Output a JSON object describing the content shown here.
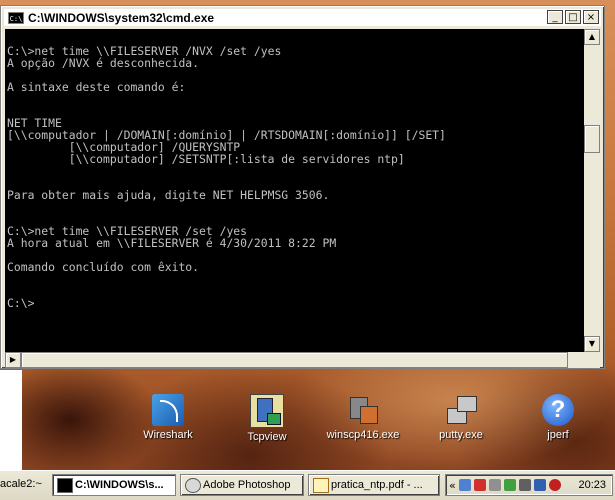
{
  "window": {
    "title": "C:\\WINDOWS\\system32\\cmd.exe",
    "icon_label": "C:\\",
    "buttons": {
      "minimize": "_",
      "maximize": "□",
      "close": "×"
    }
  },
  "console": {
    "lines": [
      "",
      "C:\\>net time \\\\FILESERVER /NVX /set /yes",
      "A opção /NVX é desconhecida.",
      "",
      "A sintaxe deste comando é:",
      "",
      "",
      "NET TIME",
      "[\\\\computador | /DOMAIN[:domínio] | /RTSDOMAIN[:domínio]] [/SET]",
      "         [\\\\computador] /QUERYSNTP",
      "         [\\\\computador] /SETSNTP[:lista de servidores ntp]",
      "",
      "",
      "Para obter mais ajuda, digite NET HELPMSG 3506.",
      "",
      "",
      "C:\\>net time \\\\FILESERVER /set /yes",
      "A hora atual em \\\\FILESERVER é 4/30/2011 8:22 PM",
      "",
      "Comando concluído com êxito.",
      "",
      "",
      "C:\\>"
    ]
  },
  "desktop": {
    "icons": [
      {
        "label": "Wireshark",
        "icon": "wireshark-icon"
      },
      {
        "label": "Tcpview",
        "icon": "tcpview-icon"
      },
      {
        "label": "winscp416.exe",
        "icon": "winscp-icon"
      },
      {
        "label": "putty.exe",
        "icon": "putty-icon"
      },
      {
        "label": "jperf",
        "icon": "jperf-icon",
        "glyph": "?"
      }
    ],
    "left_label": "acale2:~"
  },
  "taskbar": {
    "partial": "acale2:~",
    "buttons": [
      {
        "label": "C:\\WINDOWS\\s...",
        "icon": "cmd-icon",
        "active": true
      },
      {
        "label": "Adobe Photoshop",
        "icon": "photoshop-icon",
        "active": false
      },
      {
        "label": "pratica_ntp.pdf - ...",
        "icon": "pdf-icon",
        "active": false
      }
    ],
    "tray_arrow": "«",
    "clock": "20:23"
  }
}
